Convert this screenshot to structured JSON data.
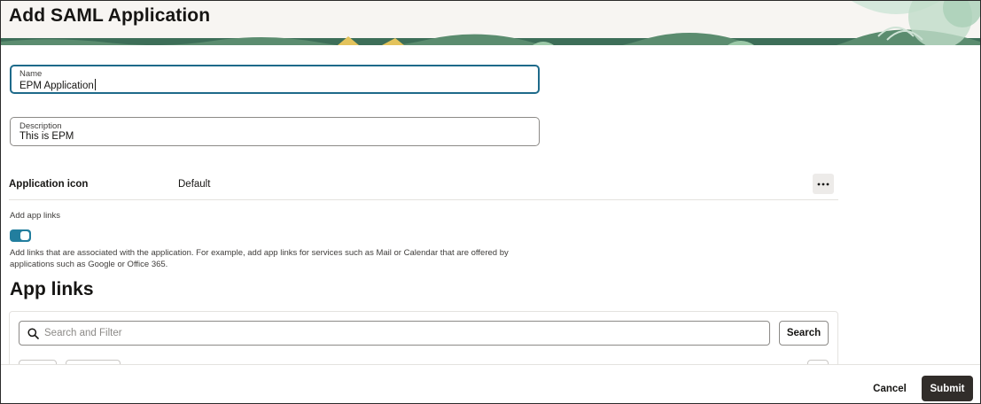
{
  "page": {
    "title": "Add SAML Application"
  },
  "form": {
    "name": {
      "label": "Name",
      "value": "EPM Application"
    },
    "description": {
      "label": "Description",
      "value": "This is EPM"
    },
    "application_icon": {
      "label": "Application icon",
      "value": "Default",
      "more_icon": "ellipsis-icon"
    },
    "add_app_links": {
      "label": "Add app links",
      "enabled": true,
      "help": "Add links that are associated with the application. For example, add app links for services such as Mail or Calendar that are offered by applications such as Google or Office 365."
    }
  },
  "app_links": {
    "heading": "App links",
    "search": {
      "placeholder": "Search and Filter",
      "icon": "search-icon",
      "button_label": "Search"
    }
  },
  "footer": {
    "cancel_label": "Cancel",
    "submit_label": "Submit"
  },
  "colors": {
    "focus_border": "#1e6a8a",
    "toggle_on": "#227e9e",
    "submit_bg": "#312d2a",
    "header_bg": "#f7f5f2"
  }
}
